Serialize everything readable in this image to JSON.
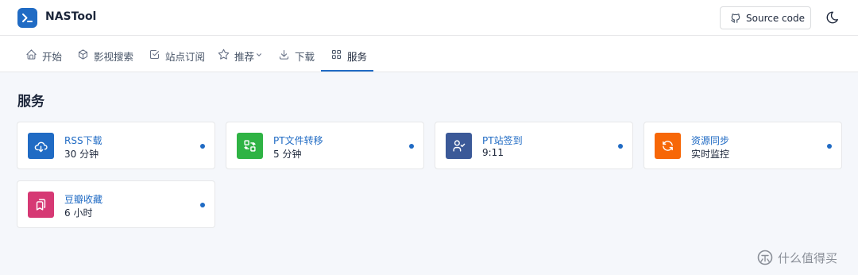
{
  "app": {
    "name": "NASTool",
    "logo_icon": "terminal-icon",
    "accent": "#206bc4"
  },
  "header": {
    "source_code_label": "Source code"
  },
  "nav": {
    "items": [
      {
        "label": "开始",
        "icon": "home-icon"
      },
      {
        "label": "影视搜索",
        "icon": "box-icon"
      },
      {
        "label": "站点订阅",
        "icon": "checkbox-icon"
      },
      {
        "label": "推荐",
        "icon": "star-icon"
      },
      {
        "label": "下载",
        "icon": "download-icon"
      },
      {
        "label": "服务",
        "icon": "apps-icon"
      }
    ],
    "active": "服务"
  },
  "page": {
    "title": "服务"
  },
  "services": [
    {
      "name": "RSS下载",
      "detail": "30 分钟",
      "icon": "cloud-download-icon",
      "color": "#206bc4"
    },
    {
      "name": "PT文件转移",
      "detail": "5 分钟",
      "icon": "transfer-icon",
      "color": "#2fb344"
    },
    {
      "name": "PT站签到",
      "detail": "9:11",
      "icon": "user-check-icon",
      "color": "#3b5998"
    },
    {
      "name": "资源同步",
      "detail": "实时监控",
      "icon": "refresh-icon",
      "color": "#f76707"
    },
    {
      "name": "豆瓣收藏",
      "detail": "6 小时",
      "icon": "bookmarks-icon",
      "color": "#d63939"
    }
  ],
  "watermark": {
    "text": "什么值得买"
  }
}
